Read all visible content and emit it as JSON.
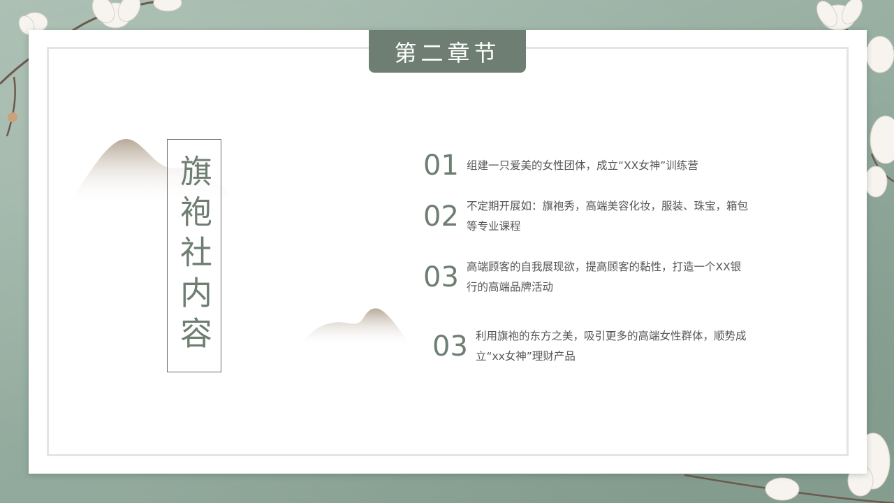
{
  "tab": {
    "label": "第二章节"
  },
  "title": {
    "text": "旗袍社内容"
  },
  "items": [
    {
      "num": "01",
      "text": "组建一只爱美的女性团体，成立“XX女神”训练营"
    },
    {
      "num": "02",
      "text": "不定期开展如：旗袍秀，高端美容化妆，服装、珠宝，箱包等专业课程"
    },
    {
      "num": "03",
      "text": "高端顾客的自我展现欲，提高顾客的黏性，打造一个XX银行的高端品牌活动"
    },
    {
      "num": "03",
      "text": "利用旗袍的东方之美，吸引更多的高端女性群体，顺势成立“xx女神”理财产品"
    }
  ],
  "colors": {
    "accent": "#6e7e72",
    "background": "#9fb4a8",
    "text": "#555555"
  }
}
